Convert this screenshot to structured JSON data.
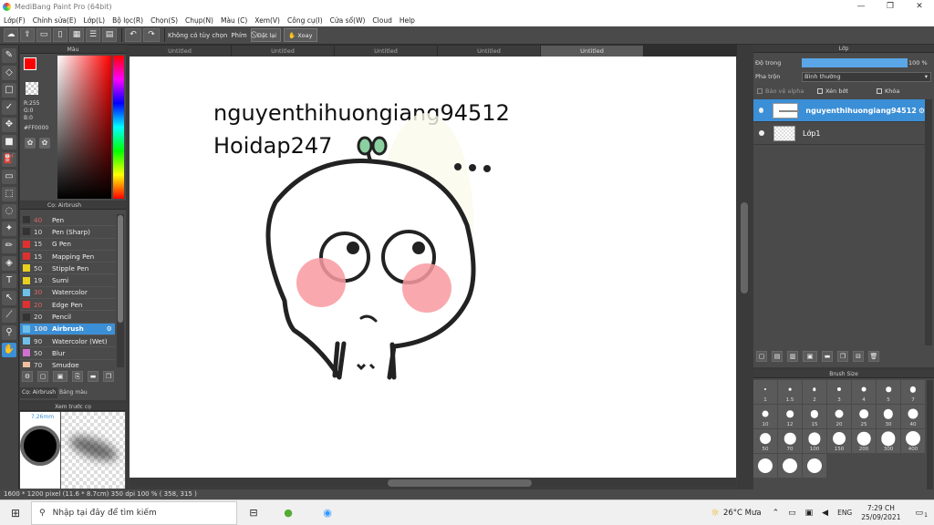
{
  "window": {
    "title": "MediBang Paint Pro (64bit)",
    "buttons": [
      "—",
      "❐",
      "✕"
    ]
  },
  "menu": [
    "Lớp(F)",
    "Chỉnh sửa(E)",
    "Lớp(L)",
    "Bộ lọc(R)",
    "Chọn(S)",
    "Chụp(N)",
    "Màu (C)",
    "Xem(V)",
    "Công cụ(I)",
    "Cửa sổ(W)",
    "Cloud",
    "Help"
  ],
  "toolbar": {
    "no_fix_label": "Không có tùy chọn",
    "shortcut_label": "Phím",
    "reset_label": "Đặt lại",
    "rotate_label": "Xoay"
  },
  "color_panel": {
    "title": "Màu",
    "r": "R:255",
    "g": "G:0",
    "b": "B:0",
    "hex": "#FF0000",
    "fg_color": "#ff0000"
  },
  "brush_panel": {
    "title": "Cọ: Airbrush",
    "items": [
      {
        "size": "40",
        "name": "Pen",
        "color": "#333333",
        "dim": true
      },
      {
        "size": "10",
        "name": "Pen (Sharp)",
        "color": "#333333"
      },
      {
        "size": "15",
        "name": "G Pen",
        "color": "#e03030"
      },
      {
        "size": "15",
        "name": "Mapping Pen",
        "color": "#e03030"
      },
      {
        "size": "50",
        "name": "Stipple Pen",
        "color": "#e8d020"
      },
      {
        "size": "19",
        "name": "Sumi",
        "color": "#e8d020"
      },
      {
        "size": "30",
        "name": "Watercolor",
        "color": "#6ec0e8",
        "dim": true
      },
      {
        "size": "20",
        "name": "Edge Pen",
        "color": "#e03030",
        "dim": true
      },
      {
        "size": "20",
        "name": "Pencil",
        "color": "#333333"
      },
      {
        "size": "100",
        "name": "Airbrush",
        "color": "#6ec0e8",
        "selected": true
      },
      {
        "size": "90",
        "name": "Watercolor (Wet)",
        "color": "#6ec0e8"
      },
      {
        "size": "50",
        "name": "Blur",
        "color": "#d070d0"
      },
      {
        "size": "70",
        "name": "Smudge",
        "color": "#f0c0a0"
      }
    ],
    "tab_brush": "Cọ: Airbrush",
    "tab_palette": "Bảng màu"
  },
  "preview_panel": {
    "title": "Xem trước cọ",
    "size": "7.26mm"
  },
  "canvas_tabs": [
    "Untitled",
    "Untitled",
    "Untitled",
    "Untitled",
    "Untitled"
  ],
  "canvas": {
    "line1": "nguyenthihuongiang94512",
    "line2": "Hoidap247"
  },
  "status": "1600 * 1200 pixel    (11.6 * 8.7cm)  350 dpi   100 %   ( 358, 315 )",
  "layer_panel": {
    "title": "Lớp",
    "opacity_label": "Độ trong",
    "opacity_value": "100 %",
    "blend_label": "Pha trộn",
    "blend_value": "Bình thường",
    "protect_alpha": "Bảo vệ alpha",
    "clipping": "Xén bớt",
    "lock": "Khóa",
    "layers": [
      {
        "name": "nguyenthihuongiang94512",
        "selected": true
      },
      {
        "name": "Lớp1",
        "selected": false
      }
    ]
  },
  "brush_size_panel": {
    "title": "Brush Size",
    "sizes": [
      "1",
      "1.5",
      "2",
      "3",
      "4",
      "5",
      "7",
      "10",
      "12",
      "15",
      "20",
      "25",
      "30",
      "40",
      "50",
      "70",
      "100",
      "150",
      "200",
      "300",
      "400",
      "",
      "",
      ""
    ]
  },
  "taskbar": {
    "search_placeholder": "Nhập tại đây để tìm kiếm",
    "weather": "26°C  Mưa",
    "lang": "ENG",
    "time": "7:29 CH",
    "date": "25/09/2021",
    "notif": "1"
  }
}
